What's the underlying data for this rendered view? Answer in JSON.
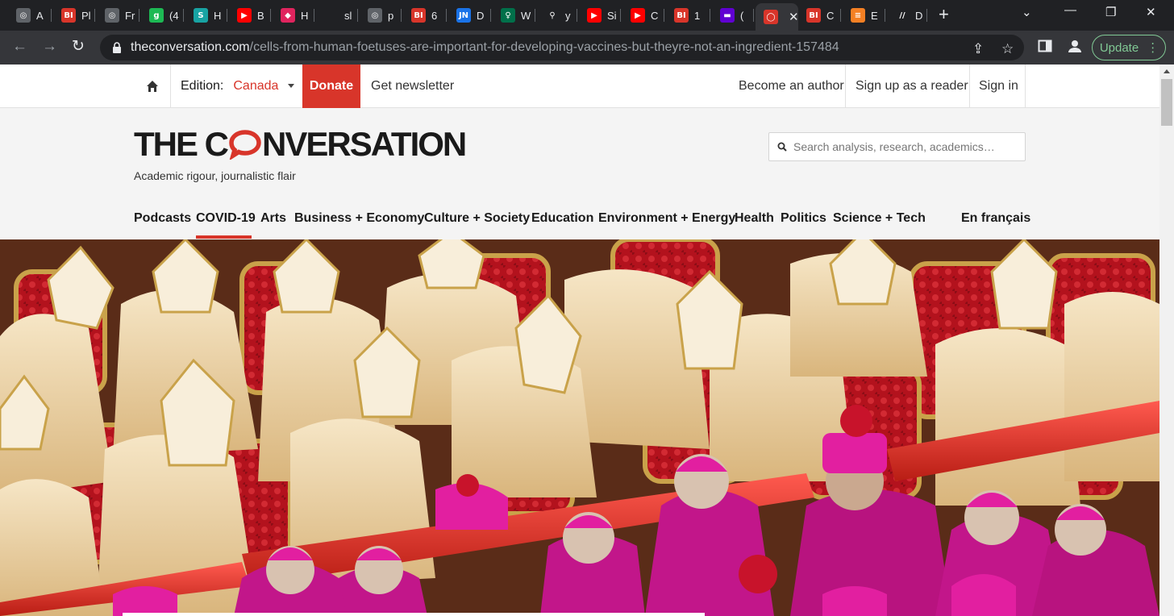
{
  "browser": {
    "tabs": [
      {
        "title": "A",
        "icon": "globe-icon",
        "color": "#5f6368",
        "glyph": "◎"
      },
      {
        "title": "Pl",
        "icon": "bi-logo-icon",
        "color": "#d8352a",
        "glyph": "BI"
      },
      {
        "title": "Fr",
        "icon": "globe-icon",
        "color": "#5f6368",
        "glyph": "◎"
      },
      {
        "title": "(4",
        "icon": "g-logo-icon",
        "color": "#1db954",
        "glyph": "g"
      },
      {
        "title": "H",
        "icon": "stat-logo-icon",
        "color": "#18a3a3",
        "glyph": "S"
      },
      {
        "title": "B",
        "icon": "youtube-icon",
        "color": "#ff0000",
        "glyph": "▶"
      },
      {
        "title": "H",
        "icon": "podcast-icon",
        "color": "#e0245e",
        "glyph": "◆"
      },
      {
        "title": "sl",
        "icon": "blank-icon",
        "color": "#202124",
        "glyph": ""
      },
      {
        "title": "p",
        "icon": "globe-icon",
        "color": "#5f6368",
        "glyph": "◎"
      },
      {
        "title": "6",
        "icon": "bi-logo-icon",
        "color": "#d8352a",
        "glyph": "BI"
      },
      {
        "title": "D",
        "icon": "jn-logo-icon",
        "color": "#1a73e8",
        "glyph": "JN"
      },
      {
        "title": "W",
        "icon": "starbucks-icon",
        "color": "#00704a",
        "glyph": "♀"
      },
      {
        "title": "y",
        "icon": "search-icon",
        "color": "#202124",
        "glyph": "⚲"
      },
      {
        "title": "Si",
        "icon": "youtube-icon",
        "color": "#ff0000",
        "glyph": "▶"
      },
      {
        "title": "C",
        "icon": "youtube-icon",
        "color": "#ff0000",
        "glyph": "▶"
      },
      {
        "title": "1",
        "icon": "bi-logo-icon",
        "color": "#d8352a",
        "glyph": "BI"
      },
      {
        "title": "(",
        "icon": "yahoo-icon",
        "color": "#6001d2",
        "glyph": "▬"
      },
      {
        "title": "",
        "icon": "conversation-icon",
        "color": "#d8352a",
        "glyph": "◯",
        "active": true
      },
      {
        "title": "C",
        "icon": "bi-logo-icon",
        "color": "#d8352a",
        "glyph": "BI"
      },
      {
        "title": "E",
        "icon": "stack-icon",
        "color": "#f48024",
        "glyph": "≡"
      },
      {
        "title": "D",
        "icon": "doc-icon",
        "color": "#202124",
        "glyph": "//"
      }
    ],
    "url_host": "theconversation.com",
    "url_path": "/cells-from-human-foetuses-are-important-for-developing-vaccines-but-theyre-not-an-ingredient-157484",
    "update_label": "Update"
  },
  "site": {
    "edition_label": "Edition:",
    "edition_value": "Canada",
    "donate_label": "Donate",
    "newsletter_label": "Get newsletter",
    "become_author": "Become an author",
    "sign_up": "Sign up as a reader",
    "sign_in": "Sign in",
    "logo_left": "THE C",
    "logo_right": "NVERSATION",
    "tagline": "Academic rigour, journalistic flair",
    "search_placeholder": "Search analysis, research, academics…",
    "nav": [
      "Podcasts",
      "COVID-19",
      "Arts",
      "Business + Economy",
      "Culture + Society",
      "Education",
      "Environment + Energy",
      "Health",
      "Politics",
      "Science + Tech"
    ],
    "nav_active": "COVID-19",
    "french_label": "En français",
    "brand_color": "#d8352a"
  }
}
